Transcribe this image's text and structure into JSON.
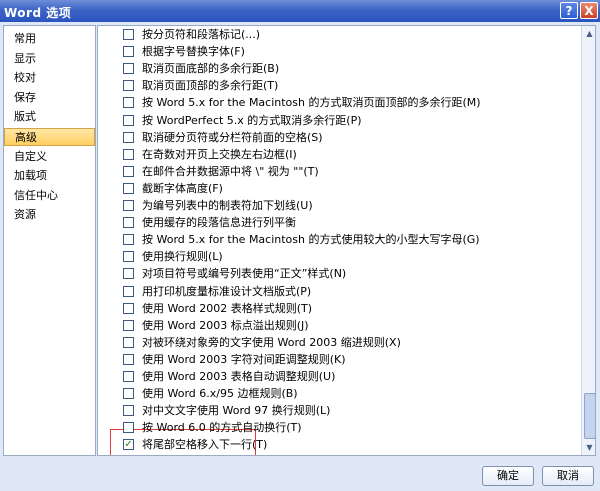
{
  "window": {
    "title": "Word 选项",
    "help_label": "?",
    "close_label": "X"
  },
  "sidebar": {
    "items": [
      {
        "label": "常用"
      },
      {
        "label": "显示"
      },
      {
        "label": "校对"
      },
      {
        "label": "保存"
      },
      {
        "label": "版式"
      },
      {
        "label": "高级"
      },
      {
        "label": "自定义"
      },
      {
        "label": "加载项"
      },
      {
        "label": "信任中心"
      },
      {
        "label": "资源"
      }
    ],
    "selected_index": 5
  },
  "options": [
    {
      "label": "按分页符和段落标记(...)",
      "checked": false
    },
    {
      "label": "根据字号替换字体(F)",
      "checked": false
    },
    {
      "label": "取消页面底部的多余行距(B)",
      "checked": false
    },
    {
      "label": "取消页面顶部的多余行距(T)",
      "checked": false
    },
    {
      "label": "按 Word 5.x for the Macintosh 的方式取消页面顶部的多余行距(M)",
      "checked": false
    },
    {
      "label": "按 WordPerfect 5.x 的方式取消多余行距(P)",
      "checked": false
    },
    {
      "label": "取消硬分页符或分栏符前面的空格(S)",
      "checked": false
    },
    {
      "label": "在奇数对开页上交换左右边框(I)",
      "checked": false
    },
    {
      "label": "在邮件合并数据源中将 \\\" 视为 \"\"(T)",
      "checked": false
    },
    {
      "label": "截断字体高度(F)",
      "checked": false
    },
    {
      "label": "为编号列表中的制表符加下划线(U)",
      "checked": false
    },
    {
      "label": "使用缓存的段落信息进行列平衡",
      "checked": false
    },
    {
      "label": "按 Word 5.x for the Macintosh 的方式使用较大的小型大写字母(G)",
      "checked": false
    },
    {
      "label": "使用换行规则(L)",
      "checked": false
    },
    {
      "label": "对项目符号或编号列表使用“正文”样式(N)",
      "checked": false
    },
    {
      "label": "用打印机度量标准设计文档版式(P)",
      "checked": false
    },
    {
      "label": "使用 Word 2002 表格样式规则(T)",
      "checked": false
    },
    {
      "label": "使用 Word 2003 标点溢出规则(J)",
      "checked": false
    },
    {
      "label": "对被环绕对象旁的文字使用 Word 2003 缩进规则(X)",
      "checked": false
    },
    {
      "label": "使用 Word 2003 字符对间距调整规则(K)",
      "checked": false
    },
    {
      "label": "使用 Word 2003 表格自动调整规则(U)",
      "checked": false
    },
    {
      "label": "使用 Word 6.x/95 边框规则(B)",
      "checked": false
    },
    {
      "label": "对中文文字使用 Word 97 换行规则(L)",
      "checked": false
    },
    {
      "label": "按 Word 6.0 的方式自动换行(T)",
      "checked": false
    },
    {
      "label": "将尾部空格移入下一行(T)",
      "checked": true
    }
  ],
  "buttons": {
    "ok_label": "确定",
    "cancel_label": "取消"
  },
  "icons": {
    "scroll_up": "▲",
    "scroll_down": "▼"
  }
}
